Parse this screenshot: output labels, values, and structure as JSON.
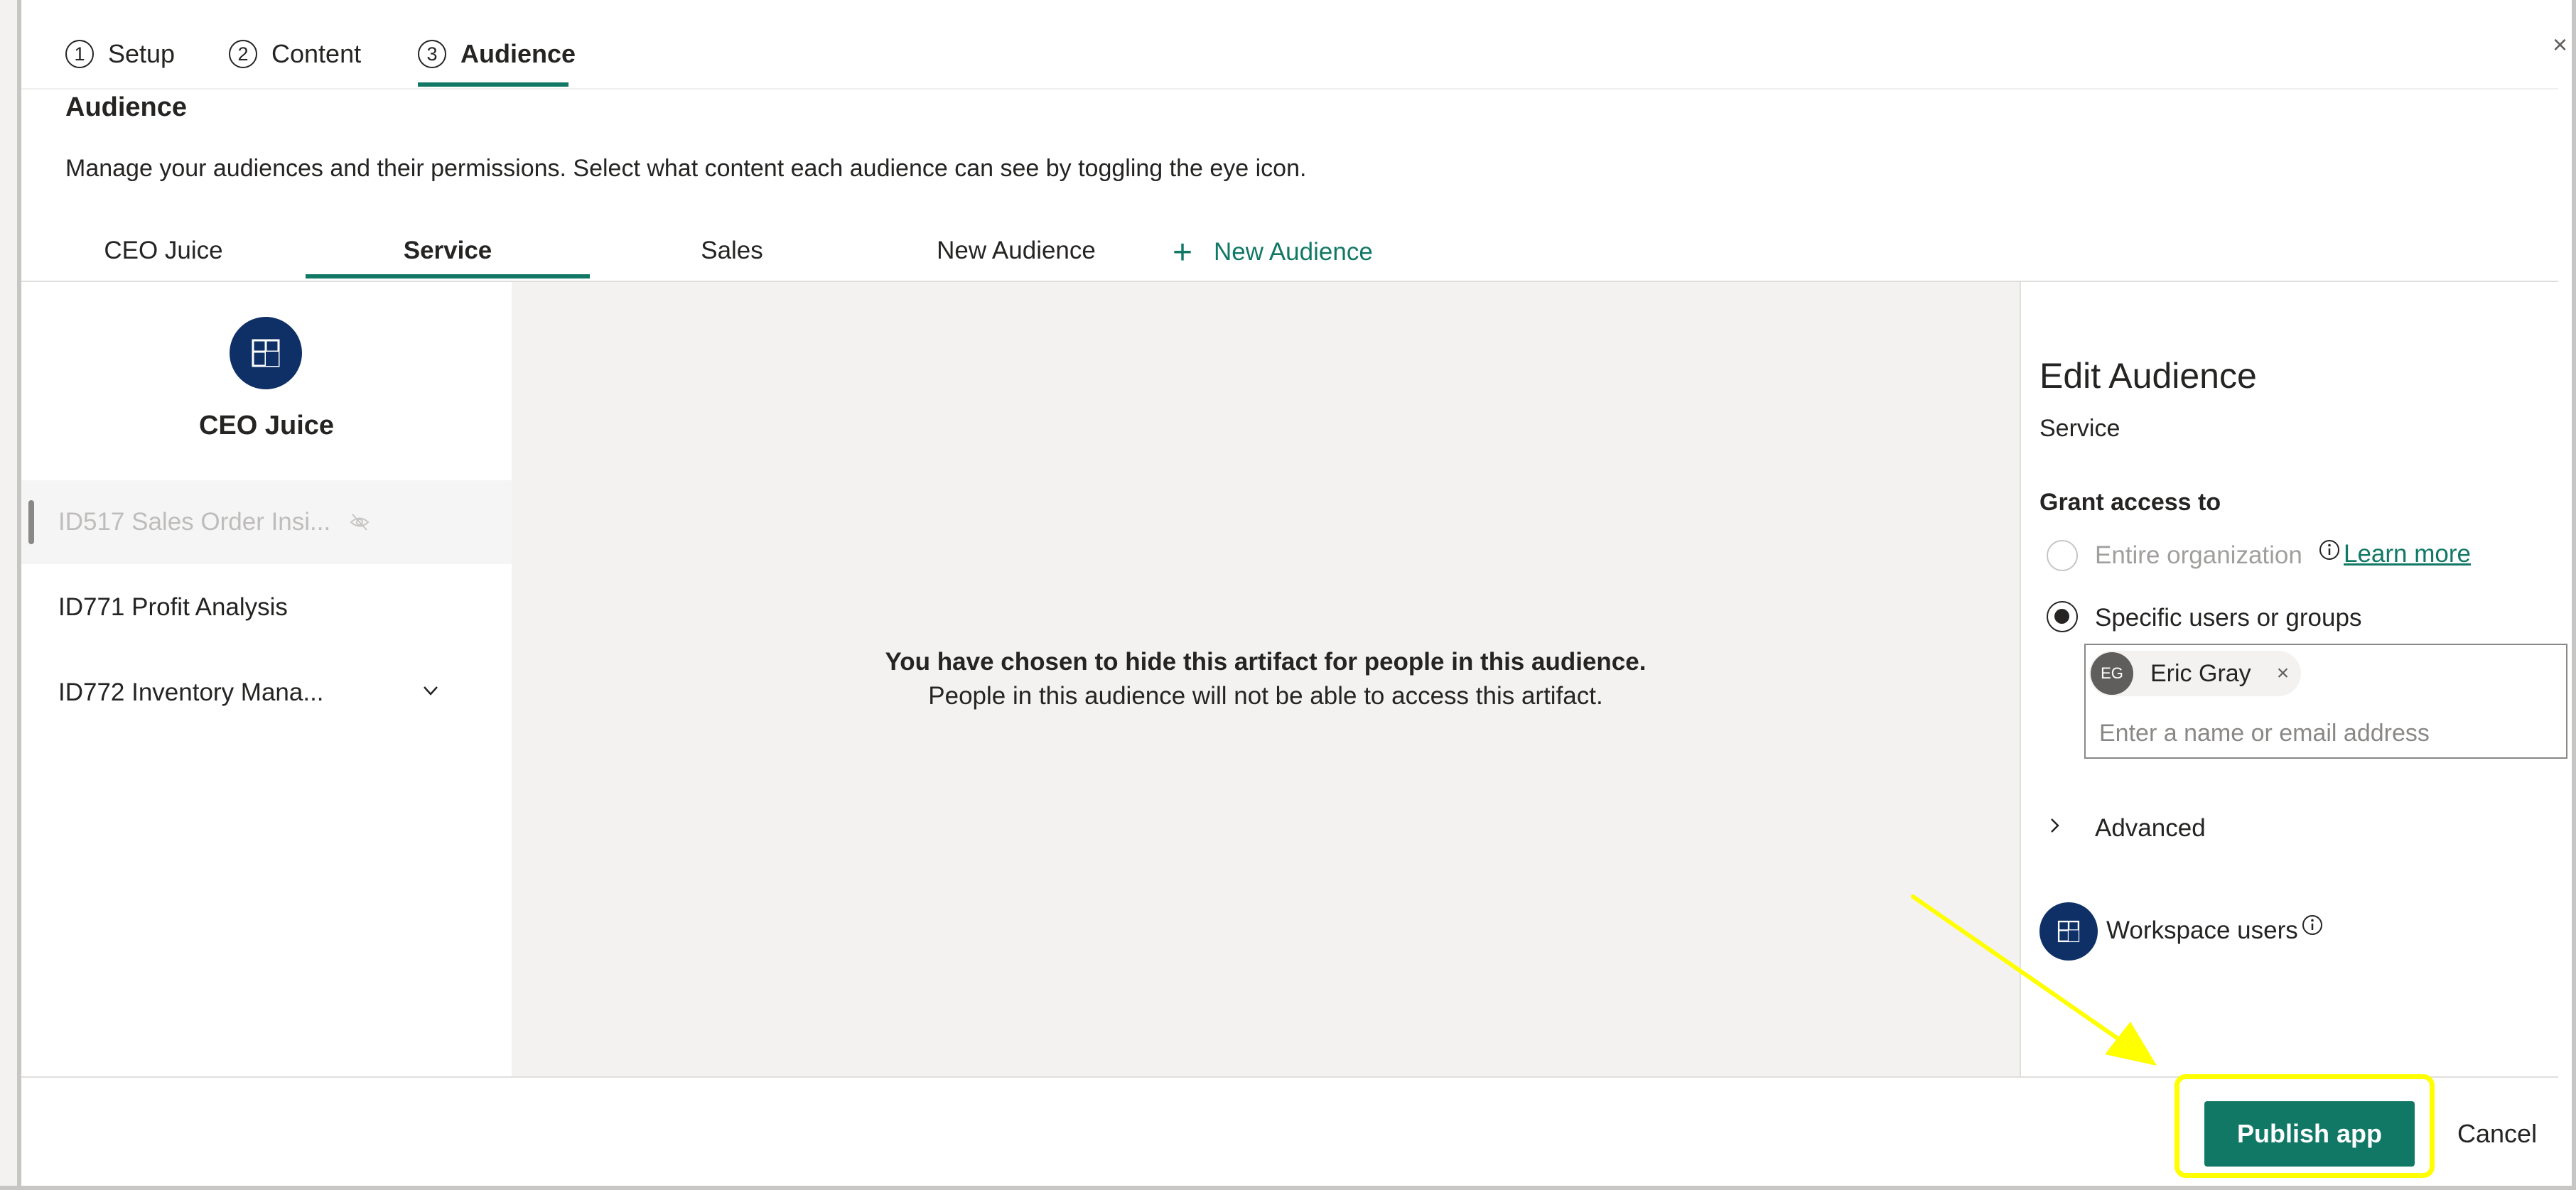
{
  "stepper": {
    "steps": [
      {
        "num": "1",
        "label": "Setup"
      },
      {
        "num": "2",
        "label": "Content"
      },
      {
        "num": "3",
        "label": "Audience"
      }
    ],
    "close_label": "×"
  },
  "audience": {
    "title": "Audience",
    "description": "Manage your audiences and their permissions. Select what content each audience can see by toggling the eye icon."
  },
  "tabs": [
    "CEO Juice",
    "Service",
    "Sales",
    "New Audience"
  ],
  "add_tab_label": "New Audience",
  "app": {
    "name": "CEO Juice"
  },
  "nav_items": [
    "ID517 Sales Order Insi...",
    "ID771 Profit Analysis",
    "ID772 Inventory Mana..."
  ],
  "center": {
    "hidden_title": "You have chosen to hide this artifact for people in this audience.",
    "hidden_desc": "People in this audience will not be able to access this artifact."
  },
  "edit": {
    "title": "Edit Audience",
    "subtitle": "Service",
    "grant_title": "Grant access to",
    "option_entire": "Entire organization",
    "learn_more": "Learn more",
    "option_specific": "Specific users or groups",
    "chip_initials": "EG",
    "chip_name": "Eric Gray",
    "chip_remove": "×",
    "input_placeholder": "Enter a name or email address",
    "advanced": "Advanced",
    "workspace_users": "Workspace users"
  },
  "footer": {
    "publish_label": "Publish app",
    "cancel_label": "Cancel"
  },
  "colors": {
    "accent": "#117865",
    "navy": "#0f3067",
    "highlight": "#ffff00"
  }
}
